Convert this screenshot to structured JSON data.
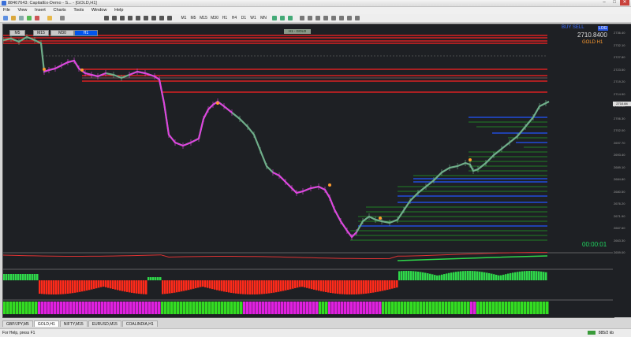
{
  "window": {
    "title": "88467643: CapitalEx-Demo - S... - [GOLD,H1]",
    "min": "–",
    "max": "□",
    "close": "✕"
  },
  "menu": [
    "File",
    "View",
    "Insert",
    "Charts",
    "Tools",
    "Window",
    "Help"
  ],
  "toolbar": {
    "timeframes": [
      "M1",
      "M5",
      "M15",
      "M30",
      "H1",
      "H4",
      "D1",
      "W1",
      "MN"
    ]
  },
  "chart": {
    "tf_buttons": [
      {
        "label": "M5",
        "active": false
      },
      {
        "label": "M15",
        "active": false
      },
      {
        "label": "M30",
        "active": false
      },
      {
        "label": "H1",
        "active": true
      }
    ],
    "center_label": "H1 - GOLD",
    "info": {
      "top_label": "BUY SELL",
      "top_tag": "LOG",
      "price": "2710.8400",
      "symbol": "GOLD  H1",
      "timer": "00:00:01"
    },
    "current_price_tag": "2710.84",
    "price_labels": [
      "2736.40",
      "2732.10",
      "2727.80",
      "2723.50",
      "2719.20",
      "2714.90",
      "2710.60",
      "2706.30",
      "2702.00",
      "2697.70",
      "2693.40",
      "2689.10",
      "2684.80",
      "2680.50",
      "2676.20",
      "2671.90",
      "2667.60",
      "2663.30",
      "2659.00"
    ],
    "colors": {
      "background": "#1e2024",
      "bull": "#6fae8a",
      "bear": "#e040e0",
      "resistance": "#ff2020",
      "support_green": "#22dd22",
      "support_blue": "#2255ff",
      "histogram_up": "#2fd84a",
      "histogram_down": "#ff2a1a",
      "bar_magenta": "#e020e0",
      "bar_green": "#33dd22"
    }
  },
  "tabs": [
    {
      "label": "GBP/JPY,M5",
      "active": false
    },
    {
      "label": "GOLD,H1",
      "active": true
    },
    {
      "label": "NIFTY,M15",
      "active": false
    },
    {
      "label": "EURUSD,M15",
      "active": false
    },
    {
      "label": "COALINDIA,H1",
      "active": false
    }
  ],
  "status": {
    "help": "For Help, press F1",
    "traffic": "885/2 kb"
  }
}
